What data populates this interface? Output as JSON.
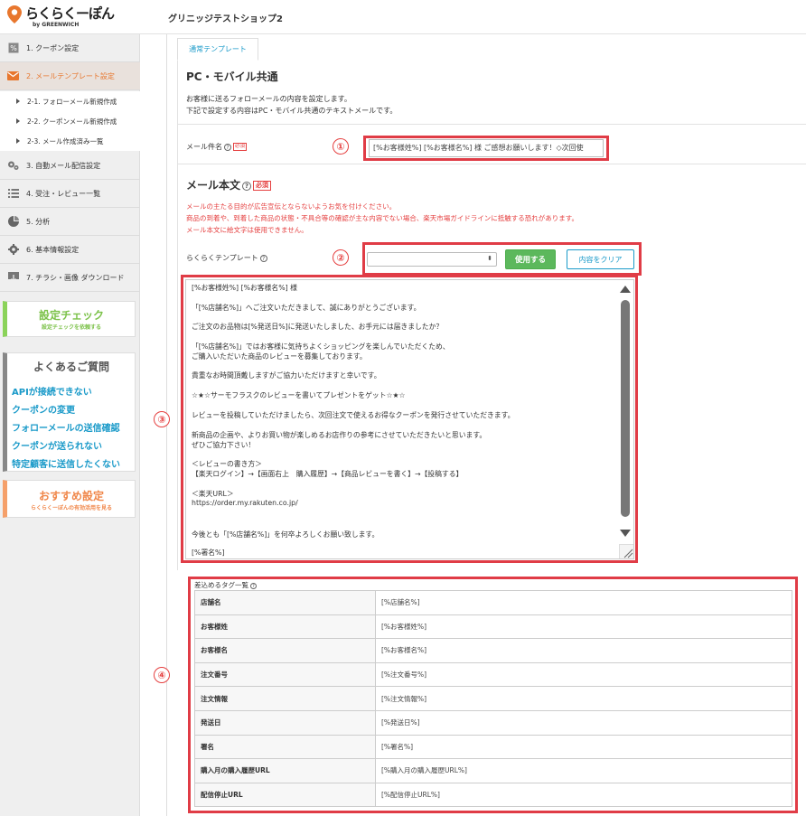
{
  "header": {
    "brand": "らくらくーぽん",
    "brand_sub": "by GREENWICH",
    "shop_name": "グリニッジテストショップ2"
  },
  "sidebar": {
    "items": [
      {
        "label": "1. クーポン設定",
        "icon": "coupon-icon"
      },
      {
        "label": "2. メールテンプレート設定",
        "icon": "mail-icon",
        "active": true
      },
      {
        "label": "3. 自動メール配信設定",
        "icon": "gears-icon"
      },
      {
        "label": "4. 受注・レビュー一覧",
        "icon": "list-icon"
      },
      {
        "label": "5. 分析",
        "icon": "pie-chart-icon"
      },
      {
        "label": "6. 基本情報設定",
        "icon": "gear-icon"
      },
      {
        "label": "7. チラシ・画像 ダウンロード",
        "icon": "download-icon"
      }
    ],
    "subitems": [
      {
        "label": "2-1. フォローメール新規作成"
      },
      {
        "label": "2-2. クーポンメール新規作成"
      },
      {
        "label": "2-3. メール作成済み一覧"
      }
    ],
    "check_card": {
      "title": "設定チェック",
      "subtitle": "設定チェックを依頼する"
    },
    "faq_card": {
      "title": "よくあるご質問",
      "questions": [
        "APIが接続できない",
        "クーポンの変更",
        "フォローメールの送信確認",
        "クーポンが送られない",
        "特定顧客に送信したくない"
      ]
    },
    "recommend_card": {
      "title": "おすすめ設定",
      "subtitle": "らくらくーぽんの有効活用を見る"
    }
  },
  "tab": {
    "label": "通常テンプレート"
  },
  "section": {
    "title": "PC・モバイル共通",
    "intro": [
      "お客様に送るフォローメールの内容を設定します。",
      "下記で設定する内容はPC・モバイル共通のテキストメールです。"
    ]
  },
  "subject": {
    "label": "メール件名",
    "required": "必須",
    "value": "[%お客様姓%] [%お客様名%] 様 ご感想お願いします！◇次回使"
  },
  "body": {
    "title": "メール本文",
    "required": "必須",
    "warnings": [
      "メールの主たる目的が広告宣伝とならないようお気を付けください。",
      "商品の到着や、到着した商品の状態・不具合等の確認が主な内容でない場合、楽天市場ガイドラインに抵触する恐れがあります。",
      "メール本文に絵文字は使用できません。"
    ],
    "lines": [
      "[%お客様姓%] [%お客様名%] 様",
      "「[%店舗名%]」へご注文いただきまして、誠にありがとうございます。",
      "ご注文のお品物は[%発送日%]に発送いたしました、お手元には届きましたか？",
      "「[%店舗名%]」ではお客様に気持ちよくショッピングを楽しんでいただくため、",
      "ご購入いただいた商品のレビューを募集しております。",
      "貴重なお時間頂戴しますがご協力いただけますと幸いです。",
      "☆★☆サーモフラスクのレビューを書いてプレゼントをゲット☆★☆",
      "レビューを投稿していただけましたら、次回注文で使えるお得なクーポンを発行させていただきます。",
      "新商品の企画や、よりお買い物が楽しめるお店作りの参考にさせていただきたいと思います。",
      "ぜひご協力下さい！",
      "＜レビューの書き方＞",
      "【楽天ログイン】→【画面右上　購入履歴】→【商品レビューを書く】→【投稿する】",
      "＜楽天URL＞",
      "https://order.my.rakuten.co.jp/",
      "今後とも「[%店舗名%]」を何卒よろしくお願い致します。",
      "[%署名%]"
    ]
  },
  "template": {
    "label": "らくらくテンプレート",
    "selected": "",
    "use_button": "使用する",
    "clear_button": "内容をクリア"
  },
  "tags": {
    "title": "差込めるタグ一覧",
    "rows": [
      {
        "name": "店舗名",
        "tag": "[%店舗名%]"
      },
      {
        "name": "お客様姓",
        "tag": "[%お客様姓%]"
      },
      {
        "name": "お客様名",
        "tag": "[%お客様名%]"
      },
      {
        "name": "注文番号",
        "tag": "[%注文番号%]"
      },
      {
        "name": "注文情報",
        "tag": "[%注文情報%]"
      },
      {
        "name": "発送日",
        "tag": "[%発送日%]"
      },
      {
        "name": "署名",
        "tag": "[%署名%]"
      },
      {
        "name": "購入月の購入履歴URL",
        "tag": "[%購入月の購入履歴URL%]"
      },
      {
        "name": "配信停止URL",
        "tag": "[%配信停止URL%]"
      }
    ]
  },
  "annotations": {
    "n1": "①",
    "n2": "②",
    "n3": "③",
    "n4": "④"
  },
  "colors": {
    "accent": "#e8772e",
    "link": "#1a9ac9",
    "success": "#5cb85c",
    "warning": "#e54040",
    "highlight": "#e03c46"
  }
}
